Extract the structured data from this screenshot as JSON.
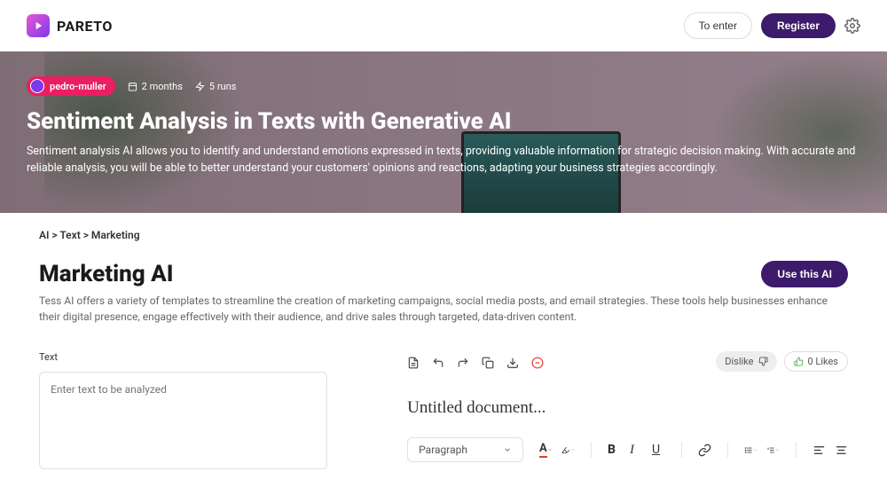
{
  "header": {
    "logo_text": "PARETO",
    "enter_label": "To enter",
    "register_label": "Register"
  },
  "hero": {
    "user": "pedro-muller",
    "age": "2 months",
    "runs": "5 runs",
    "title": "Sentiment Analysis in Texts with Generative AI",
    "description": "Sentiment analysis AI allows you to identify and understand emotions expressed in texts, providing valuable information for strategic decision making. With accurate and reliable analysis, you will be able to better understand your customers' opinions and reactions, adapting your business strategies accordingly."
  },
  "breadcrumb": "AI > Text > Marketing",
  "section": {
    "title": "Marketing AI",
    "use_label": "Use this AI",
    "description": "Tess AI offers a variety of templates to streamline the creation of marketing campaigns, social media posts, and email strategies. These tools help businesses enhance their digital presence, engage effectively with their audience, and drive sales through targeted, data-driven content."
  },
  "input": {
    "label": "Text",
    "placeholder": "Enter text to be analyzed"
  },
  "editor": {
    "dislike": "Dislike",
    "likes": "0 Likes",
    "doc_title": "Untitled document...",
    "block_type": "Paragraph"
  }
}
